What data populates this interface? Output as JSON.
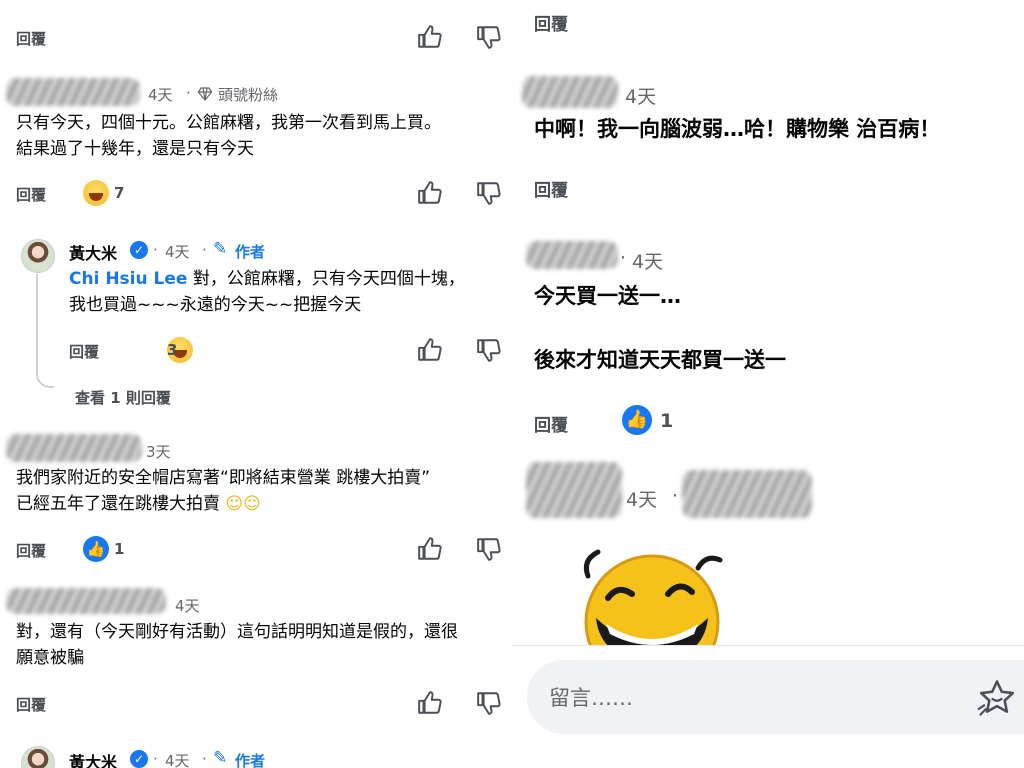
{
  "left": {
    "reply_label": "回覆",
    "comments": [
      {
        "time": "4天",
        "badge": "頭號粉絲",
        "lines": [
          "只有今天，四個十元。公館麻糬，我第一次看到馬上買。",
          "結果過了十幾年，還是只有今天"
        ],
        "reaction_count": "7"
      },
      {
        "name": "黃大米",
        "time": "4天",
        "author_label": "作者",
        "mention": "Chi Hsiu Lee",
        "lines": [
          "對，公館麻糬，只有今天四個十塊，",
          "我也買過~~~永遠的今天~~把握今天"
        ],
        "reaction_count": "3"
      },
      {
        "time": "3天",
        "lines": [
          "我們家附近的安全帽店寫著“即將結束營業 跳樓大拍賣”",
          "已經五年了還在跳樓大拍賣"
        ],
        "reaction_count": "1"
      },
      {
        "time": "4天",
        "lines": [
          "對，還有（今天剛好有活動）這句話明明知道是假的，還很",
          "願意被騙"
        ]
      },
      {
        "name": "黃大米",
        "time": "4天",
        "author_label": "作者"
      }
    ],
    "view_replies": "查看 1 則回覆"
  },
  "right": {
    "reply_label": "回覆",
    "comments": [
      {
        "time": "4天",
        "lines": [
          "中啊！我一向腦波弱…哈！購物樂 治百病！"
        ]
      },
      {
        "time": "4天",
        "lines": [
          "今天買一送一…",
          "後來才知道天天都買一送一"
        ],
        "reaction_count": "1"
      },
      {
        "time": "4天"
      }
    ],
    "comment_placeholder": "留言……"
  },
  "icons": [
    "thumbs-up-icon",
    "thumbs-down-icon",
    "diamond-icon",
    "verified-icon",
    "pencil-icon",
    "laugh-emoji-icon",
    "sticker-icon"
  ],
  "colors": {
    "link": "#1877f2",
    "text": "#050505",
    "muted": "#65676b",
    "input_bg": "#f0f2f5"
  }
}
